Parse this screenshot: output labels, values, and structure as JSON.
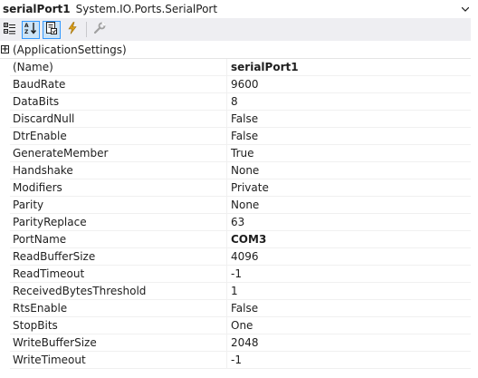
{
  "object_selector": {
    "name": "serialPort1",
    "type": "System.IO.Ports.SerialPort"
  },
  "toolbar": {
    "buttons": [
      {
        "icon": "categorized-icon",
        "checked": false
      },
      {
        "icon": "alphabetical-icon",
        "checked": true
      },
      {
        "icon": "properties-icon",
        "checked": true
      },
      {
        "icon": "events-lightning-icon",
        "checked": false
      },
      {
        "icon": "property-pages-wrench-icon",
        "checked": false
      }
    ]
  },
  "category": {
    "label": "(ApplicationSettings)",
    "expander": "+"
  },
  "properties": [
    {
      "name": "(Name)",
      "value": "serialPort1",
      "bold": true
    },
    {
      "name": "BaudRate",
      "value": "9600",
      "bold": false
    },
    {
      "name": "DataBits",
      "value": "8",
      "bold": false
    },
    {
      "name": "DiscardNull",
      "value": "False",
      "bold": false
    },
    {
      "name": "DtrEnable",
      "value": "False",
      "bold": false
    },
    {
      "name": "GenerateMember",
      "value": "True",
      "bold": false
    },
    {
      "name": "Handshake",
      "value": "None",
      "bold": false
    },
    {
      "name": "Modifiers",
      "value": "Private",
      "bold": false
    },
    {
      "name": "Parity",
      "value": "None",
      "bold": false
    },
    {
      "name": "ParityReplace",
      "value": "63",
      "bold": false
    },
    {
      "name": "PortName",
      "value": "COM3",
      "bold": true
    },
    {
      "name": "ReadBufferSize",
      "value": "4096",
      "bold": false
    },
    {
      "name": "ReadTimeout",
      "value": "-1",
      "bold": false
    },
    {
      "name": "ReceivedBytesThreshold",
      "value": "1",
      "bold": false
    },
    {
      "name": "RtsEnable",
      "value": "False",
      "bold": false
    },
    {
      "name": "StopBits",
      "value": "One",
      "bold": false
    },
    {
      "name": "WriteBufferSize",
      "value": "2048",
      "bold": false
    },
    {
      "name": "WriteTimeout",
      "value": "-1",
      "bold": false
    }
  ],
  "colors": {
    "toolbar_bg": "#eeeef2",
    "checked_bg": "#cce4f7",
    "checked_border": "#3399ff",
    "text": "#1e1e1e"
  }
}
